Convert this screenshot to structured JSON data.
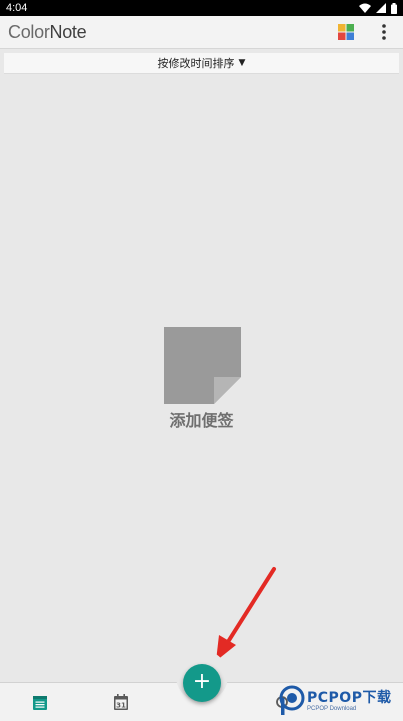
{
  "status_bar": {
    "time": "4:04",
    "icons": [
      "wifi-icon",
      "signal-icon",
      "battery-icon"
    ]
  },
  "app_bar": {
    "logo_part1": "Color",
    "logo_part2": "Note",
    "actions": [
      "palette-icon",
      "more-vert-icon"
    ]
  },
  "sort_bar": {
    "label": "按修改时间排序",
    "caret": "▼"
  },
  "empty_state": {
    "icon": "sticky-note-icon",
    "label": "添加便签"
  },
  "fab": {
    "label": "+",
    "color": "#13998a"
  },
  "bottom_nav": {
    "items": [
      "notes-list-icon",
      "calendar-icon"
    ],
    "calendar_day": "31",
    "accent": "#13998a"
  },
  "watermark": {
    "title": "PCPOP下载",
    "subtitle": "PCPOP Download"
  },
  "colors": {
    "background": "#e8e8e8",
    "annotation_arrow": "#e32a24",
    "note_icon": "#9a9a9a"
  }
}
